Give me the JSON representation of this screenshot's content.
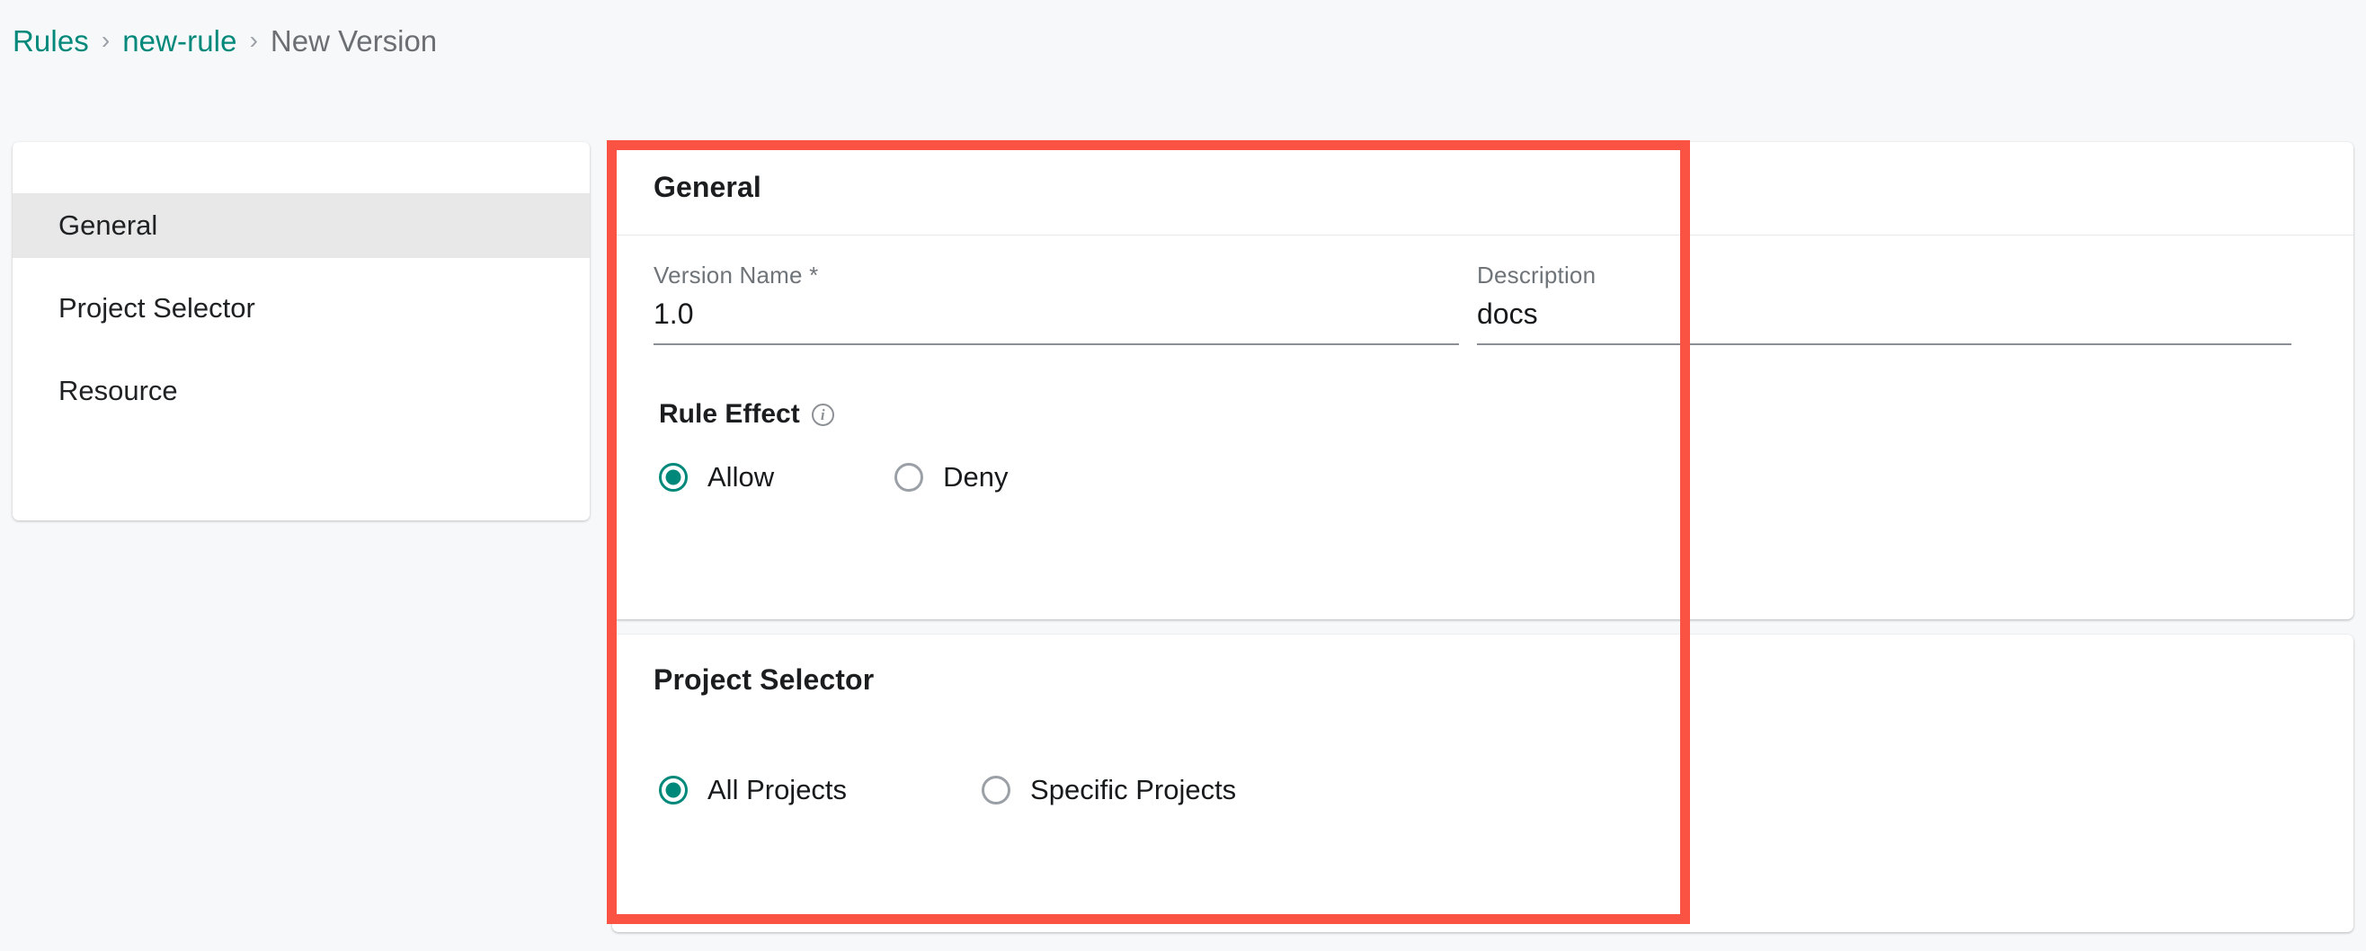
{
  "breadcrumb": {
    "items": [
      {
        "label": "Rules",
        "type": "link"
      },
      {
        "label": "new-rule",
        "type": "link"
      },
      {
        "label": "New Version",
        "type": "current"
      }
    ],
    "separator": "›"
  },
  "sidebar": {
    "items": [
      {
        "label": "General",
        "active": true
      },
      {
        "label": "Project Selector",
        "active": false
      },
      {
        "label": "Resource",
        "active": false
      }
    ]
  },
  "general_section": {
    "title": "General",
    "version_name": {
      "label": "Version Name *",
      "value": "1.0",
      "placeholder": "Version Name"
    },
    "description": {
      "label": "Description",
      "value": "docs",
      "placeholder": "Description"
    },
    "rule_effect": {
      "title": "Rule Effect",
      "info_glyph": "i",
      "options": [
        {
          "label": "Allow",
          "selected": true
        },
        {
          "label": "Deny",
          "selected": false
        }
      ]
    }
  },
  "project_selector_section": {
    "title": "Project Selector",
    "options": [
      {
        "label": "All Projects",
        "selected": true
      },
      {
        "label": "Specific Projects",
        "selected": false
      }
    ]
  },
  "annotation": {
    "highlight_color": "#fb5343"
  },
  "colors": {
    "accent_teal": "#00897b",
    "page_background": "#f7f8fa",
    "card_background": "#ffffff",
    "active_nav_background": "#e8e8e8"
  }
}
